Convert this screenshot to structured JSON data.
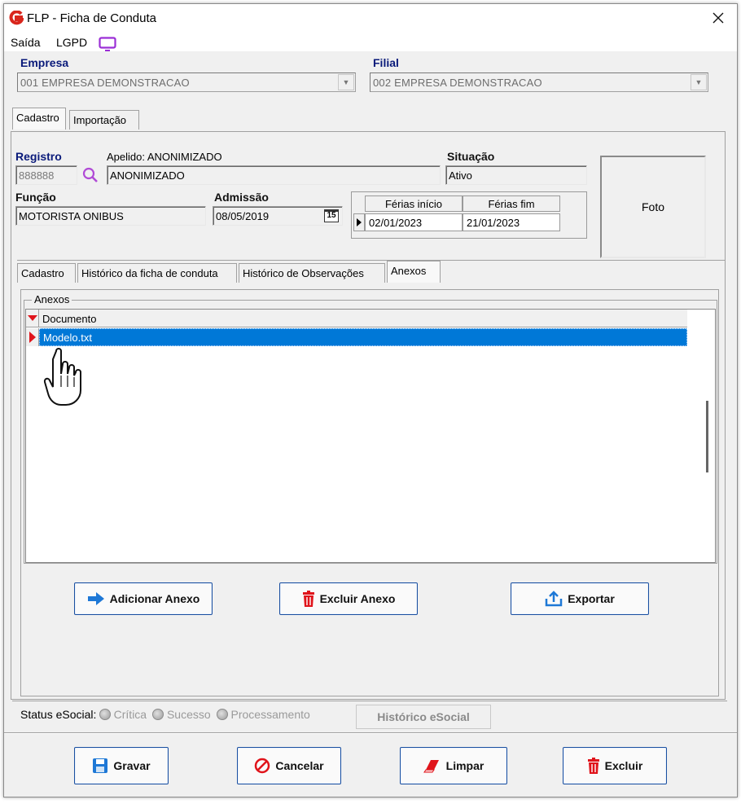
{
  "window": {
    "title": "FLP - Ficha de Conduta"
  },
  "menu": {
    "saida": "Saída",
    "lgpd": "LGPD"
  },
  "empresa": {
    "label": "Empresa",
    "value": "001 EMPRESA DEMONSTRACAO"
  },
  "filial": {
    "label": "Filial",
    "value": "002 EMPRESA DEMONSTRACAO"
  },
  "top_tabs": [
    "Cadastro",
    "Importação"
  ],
  "registro": {
    "label": "Registro",
    "value": "888888"
  },
  "apelido": {
    "label": "Apelido: ANONIMIZADO",
    "value": "ANONIMIZADO"
  },
  "situacao": {
    "label": "Situação",
    "value": "Ativo"
  },
  "funcao": {
    "label": "Função",
    "value": "MOTORISTA ONIBUS"
  },
  "admissao": {
    "label": "Admissão",
    "value": "08/05/2019",
    "calendar": "15"
  },
  "ferias": {
    "col_inicio": "Férias início",
    "col_fim": "Férias fim",
    "inicio": "02/01/2023",
    "fim": "21/01/2023"
  },
  "foto": "Foto",
  "sub_tabs": [
    "Cadastro",
    "Histórico da ficha de conduta",
    "Histórico de Observações",
    "Anexos"
  ],
  "anexos": {
    "group_title": "Anexos",
    "column": "Documento",
    "rows": [
      "Modelo.txt"
    ]
  },
  "buttons": {
    "adicionar": "Adicionar Anexo",
    "excluir_anexo": "Excluir Anexo",
    "exportar": "Exportar",
    "gravar": "Gravar",
    "cancelar": "Cancelar",
    "limpar": "Limpar",
    "excluir": "Excluir"
  },
  "status": {
    "label": "Status eSocial:",
    "critica": "Crítica",
    "sucesso": "Sucesso",
    "processamento": "Processamento",
    "historico": "Histórico eSocial"
  },
  "colors": {
    "accent": "#0078d7",
    "brand_red": "#d9261c",
    "label_blue": "#0a1a7a",
    "button_border": "#1a4fa0"
  }
}
